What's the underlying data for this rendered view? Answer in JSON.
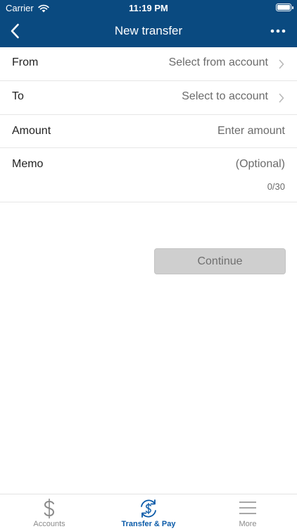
{
  "status_bar": {
    "carrier": "Carrier",
    "time": "11:19 PM"
  },
  "header": {
    "title": "New transfer"
  },
  "form": {
    "from": {
      "label": "From",
      "value": "Select from account"
    },
    "to": {
      "label": "To",
      "value": "Select to account"
    },
    "amount": {
      "label": "Amount",
      "placeholder": "Enter amount"
    },
    "memo": {
      "label": "Memo",
      "placeholder": "(Optional)",
      "counter": "0/30"
    }
  },
  "continue_label": "Continue",
  "tabs": [
    {
      "label": "Accounts",
      "icon": "dollar-icon",
      "active": false
    },
    {
      "label": "Transfer & Pay",
      "icon": "transfer-pay-icon",
      "active": true
    },
    {
      "label": "More",
      "icon": "menu-icon",
      "active": false
    }
  ],
  "colors": {
    "header_bg": "#0a4a80",
    "accent": "#0a5aa8",
    "disabled_button": "#cfcfcf"
  }
}
